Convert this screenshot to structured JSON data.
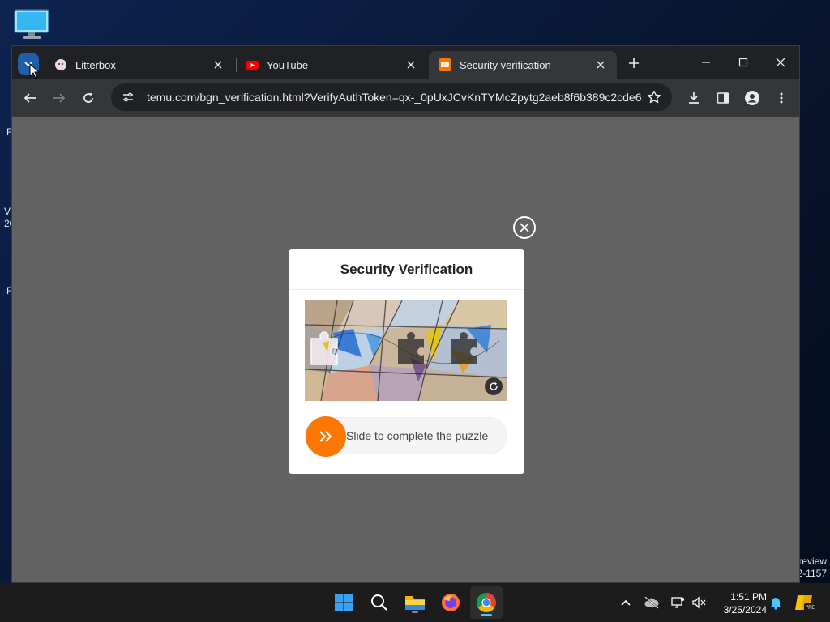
{
  "desktop": {
    "edge_labels": [
      "R",
      "Vi",
      "20",
      "F"
    ],
    "watermark_line1": "review",
    "watermark_line2": "2-1157"
  },
  "browser": {
    "tabs": [
      {
        "title": "Litterbox",
        "icon": "litterbox-favicon",
        "active": false
      },
      {
        "title": "YouTube",
        "icon": "youtube-favicon",
        "active": false
      },
      {
        "title": "Security verification",
        "icon": "temu-favicon",
        "active": true
      }
    ],
    "url": "temu.com/bgn_verification.html?VerifyAuthToken=qx-_0pUxJCvKnTYMcZpytg2aeb8f6b389c2cde6...",
    "accent": "#fb7701"
  },
  "modal": {
    "title": "Security Verification",
    "slider_text": "Slide to complete the puzzle"
  },
  "taskbar": {
    "apps": [
      "start-icon",
      "search-icon",
      "file-explorer-icon",
      "firefox-icon",
      "chrome-icon"
    ],
    "time": "1:51 PM",
    "date": "3/25/2024"
  }
}
